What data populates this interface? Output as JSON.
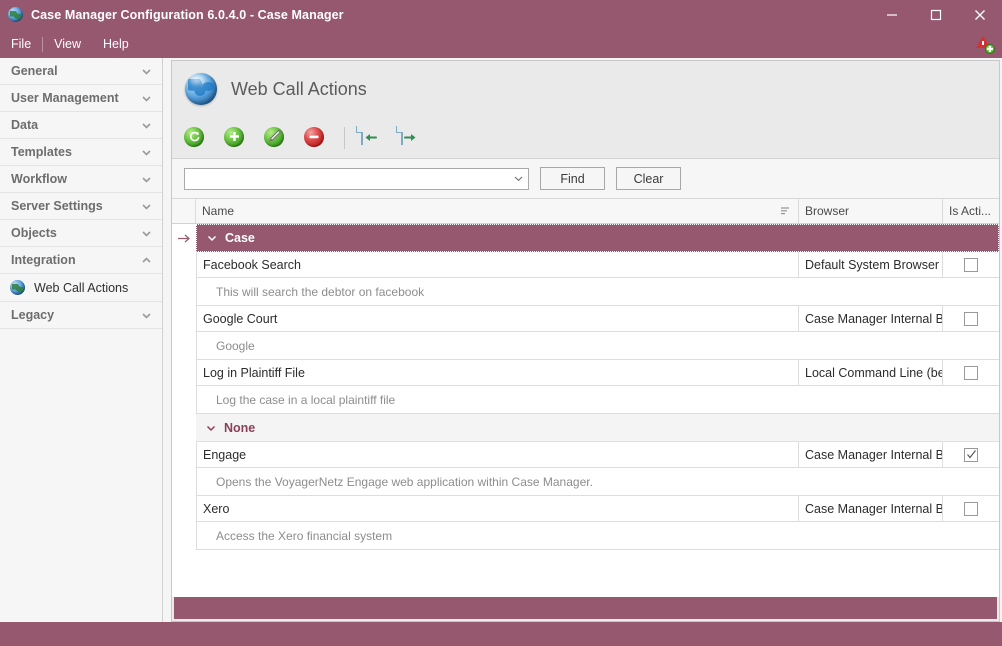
{
  "window": {
    "title": "Case Manager Configuration 6.0.4.0 - Case Manager",
    "app_icon": "globe-icon",
    "minimize_label": "Minimize",
    "maximize_label": "Maximize",
    "close_label": "Close",
    "titlebar_color": "#96586f"
  },
  "menubar": {
    "items": [
      {
        "label": "File"
      },
      {
        "label": "View"
      },
      {
        "label": "Help"
      }
    ],
    "notification_icon": "alert-plus-icon"
  },
  "sidebar": {
    "groups": [
      {
        "label": "General",
        "expanded": false,
        "chevron": "chevron-down-icon"
      },
      {
        "label": "User Management",
        "expanded": false,
        "chevron": "chevron-down-icon"
      },
      {
        "label": "Data",
        "expanded": false,
        "chevron": "chevron-down-icon"
      },
      {
        "label": "Templates",
        "expanded": false,
        "chevron": "chevron-down-icon"
      },
      {
        "label": "Workflow",
        "expanded": false,
        "chevron": "chevron-down-icon"
      },
      {
        "label": "Server Settings",
        "expanded": false,
        "chevron": "chevron-down-icon"
      },
      {
        "label": "Objects",
        "expanded": false,
        "chevron": "chevron-down-icon"
      },
      {
        "label": "Integration",
        "expanded": true,
        "chevron": "chevron-up-icon"
      }
    ],
    "integration_children": [
      {
        "label": "Web Call Actions",
        "icon": "globe-icon",
        "selected": true
      }
    ],
    "trailing_groups": [
      {
        "label": "Legacy",
        "expanded": false,
        "chevron": "chevron-down-icon"
      }
    ]
  },
  "page": {
    "icon": "globe-icon",
    "title": "Web Call Actions"
  },
  "toolbar": {
    "buttons": [
      {
        "name": "refresh-button",
        "icon": "refresh-icon",
        "color": "green"
      },
      {
        "name": "add-button",
        "icon": "plus-icon",
        "color": "green"
      },
      {
        "name": "edit-button",
        "icon": "pencil-icon",
        "color": "green"
      },
      {
        "name": "delete-button",
        "icon": "minus-circle-icon",
        "color": "red"
      },
      {
        "name": "import-button",
        "icon": "import-document-icon",
        "color": "blue"
      },
      {
        "name": "export-button",
        "icon": "export-document-icon",
        "color": "blue"
      }
    ]
  },
  "filter": {
    "search_value": "",
    "search_placeholder": "",
    "dropdown_icon": "chevron-down-icon",
    "find_label": "Find",
    "clear_label": "Clear"
  },
  "grid": {
    "columns": [
      {
        "key": "name",
        "label": "Name",
        "sort_icon": "sort-indicator-icon"
      },
      {
        "key": "browser",
        "label": "Browser"
      },
      {
        "key": "active",
        "label": "Is Acti..."
      }
    ],
    "groups": [
      {
        "label": "Case",
        "selected": true,
        "expanded": true,
        "chevron": "chevron-down-icon",
        "row_indicator": "current-row-arrow-icon",
        "rows": [
          {
            "name": "Facebook Search",
            "browser": "Default System Browser",
            "active": false,
            "description": "This will search the debtor on facebook"
          },
          {
            "name": "Google Court",
            "browser": "Case Manager Internal B...",
            "active": false,
            "description": "Google"
          },
          {
            "name": "Log in Plaintiff File",
            "browser": "Local Command Line (beta)",
            "active": false,
            "description": "Log the case in a local  plaintiff file"
          }
        ]
      },
      {
        "label": "None",
        "selected": false,
        "expanded": true,
        "chevron": "chevron-down-icon",
        "rows": [
          {
            "name": "Engage",
            "browser": "Case Manager Internal B...",
            "active": true,
            "description": "Opens the VoyagerNetz Engage web application within Case Manager."
          },
          {
            "name": "Xero",
            "browser": "Case Manager Internal B...",
            "active": false,
            "description": "Access the Xero financial system"
          }
        ]
      }
    ]
  },
  "colors": {
    "accent": "#96586f",
    "group_text": "#8c3f58",
    "panel_bg": "#eaeaea",
    "grid_bg": "#ffffff"
  }
}
